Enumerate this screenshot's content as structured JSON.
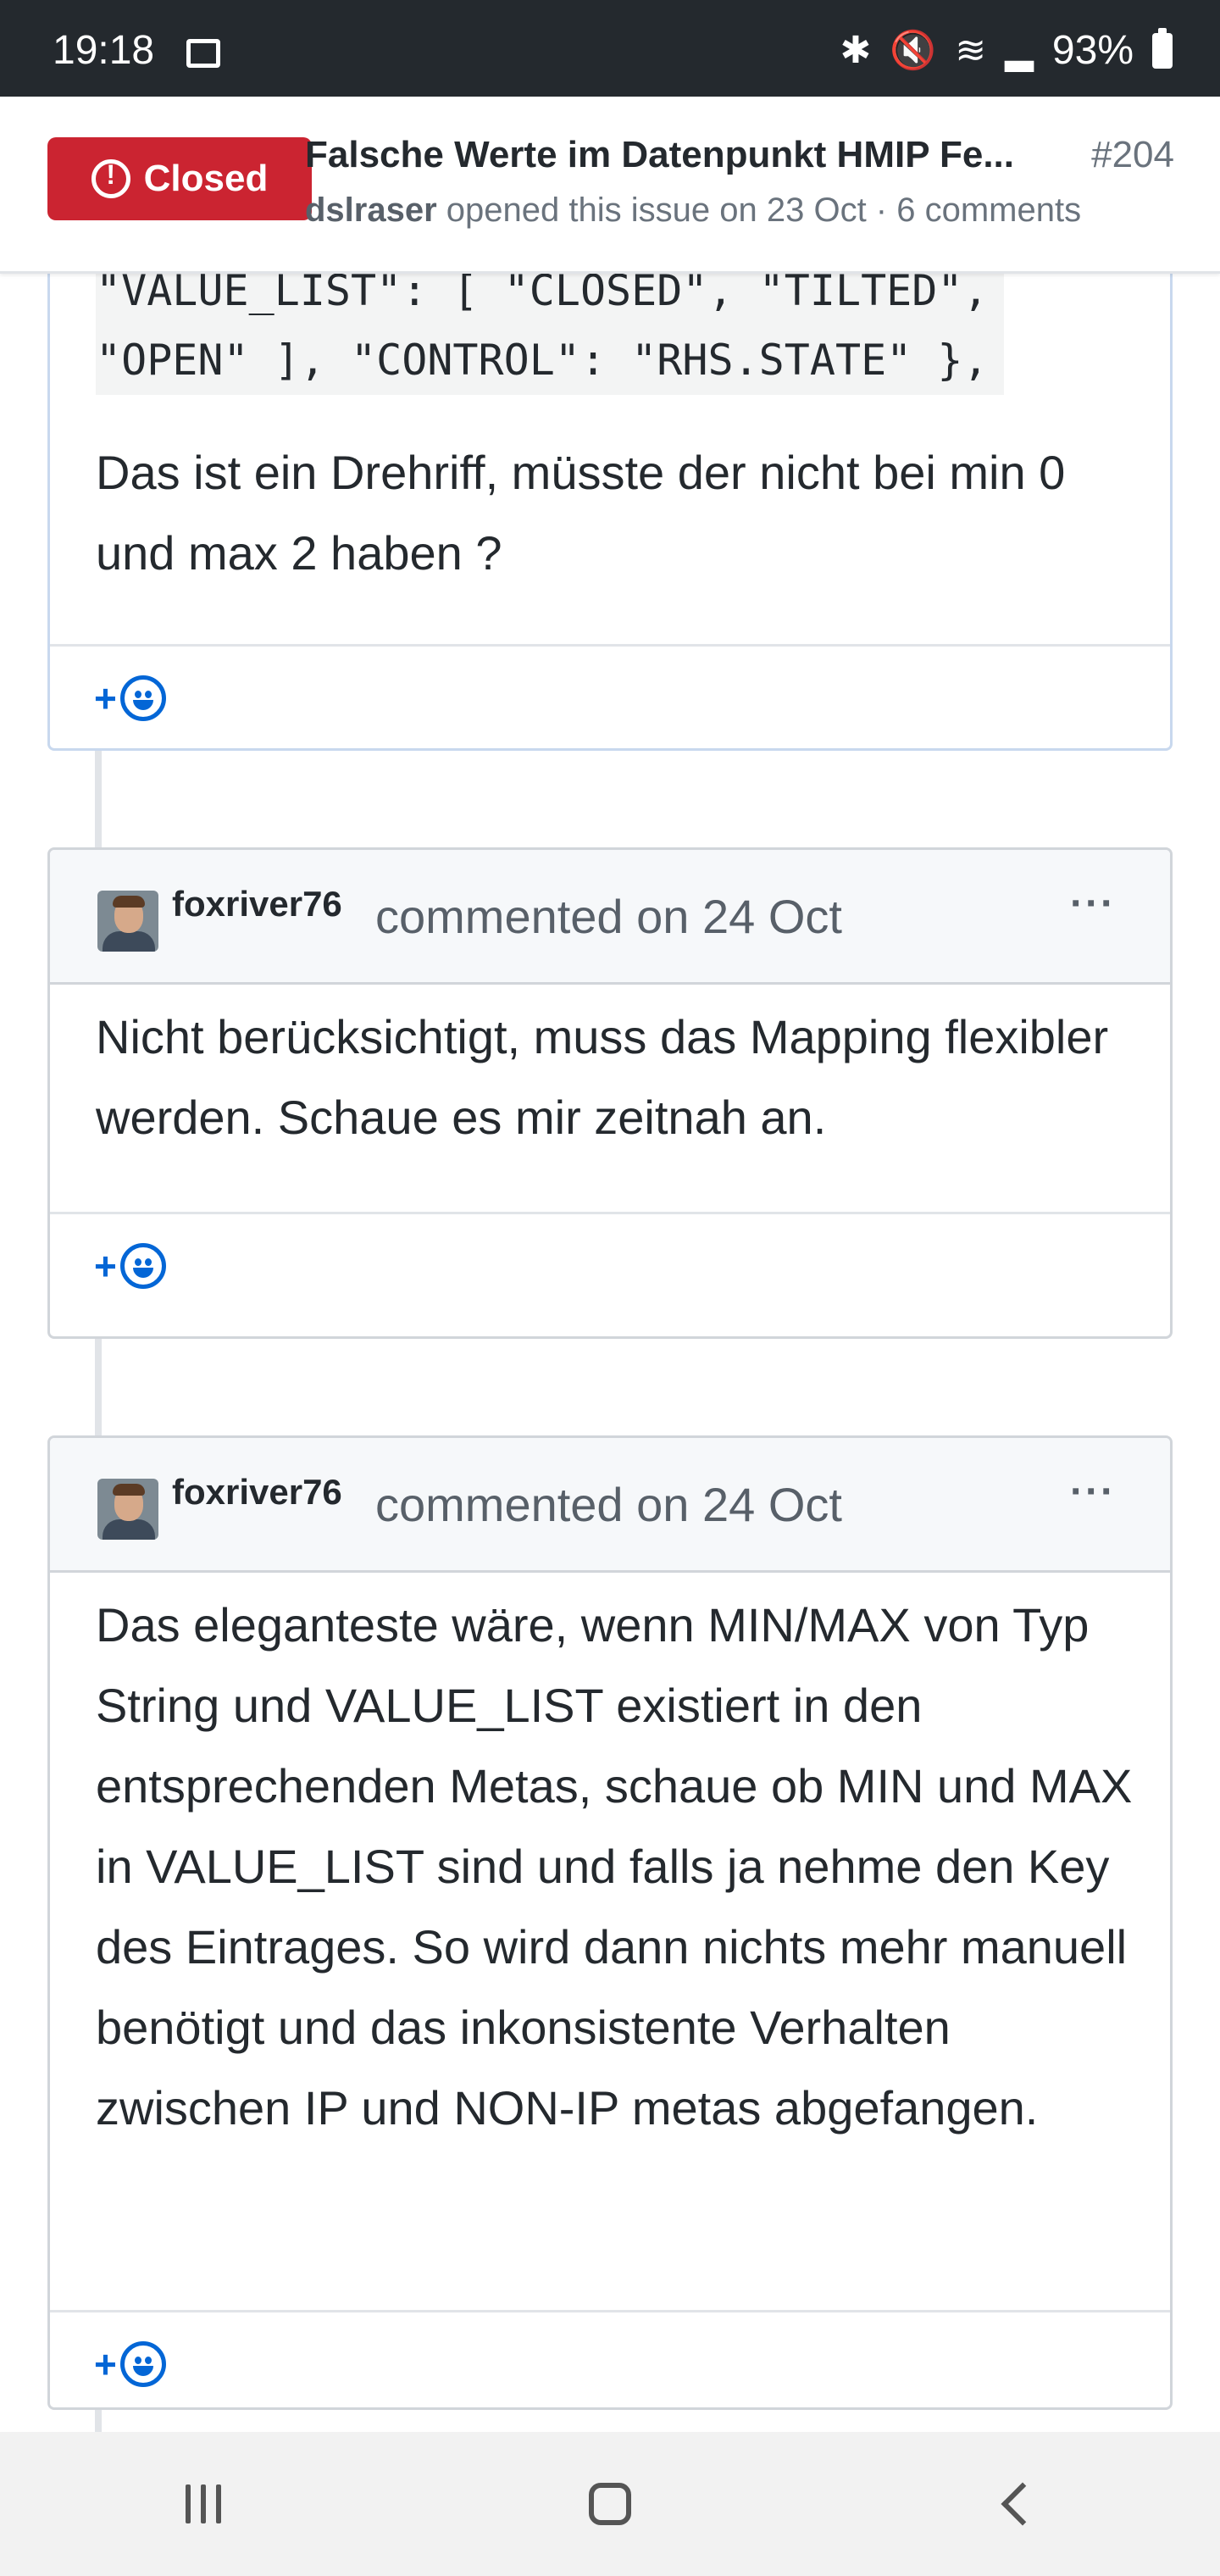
{
  "status_bar": {
    "time": "19:18",
    "battery": "93%"
  },
  "issue": {
    "state": "Closed",
    "title": "Falsche Werte im Datenpunkt HMIP Fe...",
    "number": "#204",
    "author": "dslraser",
    "meta": "opened this issue on 23 Oct · 6 comments"
  },
  "comments": [
    {
      "code": "\"VALUE_LIST\": [ \"CLOSED\", \"TILTED\",\n\"OPEN\" ], \"CONTROL\": \"RHS.STATE\" },",
      "body": "Das ist ein Drehriff, müsste der nicht bei min 0 und max 2 haben ?"
    },
    {
      "author": "foxriver76",
      "date": "commented on 24 Oct",
      "body": "Nicht berücksichtigt, muss das Mapping flexibler werden. Schaue es mir zeitnah an."
    },
    {
      "author": "foxriver76",
      "date": "commented on 24 Oct",
      "body": "Das eleganteste wäre, wenn MIN/MAX von Typ String und VALUE_LIST existiert in den entsprechenden Metas, schaue ob MIN und MAX in VALUE_LIST sind und falls ja nehme den Key des Eintrages. So wird dann nichts mehr manuell benötigt und das inkonsistente Verhalten zwischen IP und NON-IP metas abgefangen."
    }
  ],
  "reaction": {
    "plus": "+"
  },
  "menu": {
    "dots": "···"
  },
  "colors": {
    "closed": "#cb2431",
    "link": "#0366d6",
    "status_bar": "#24292e"
  }
}
